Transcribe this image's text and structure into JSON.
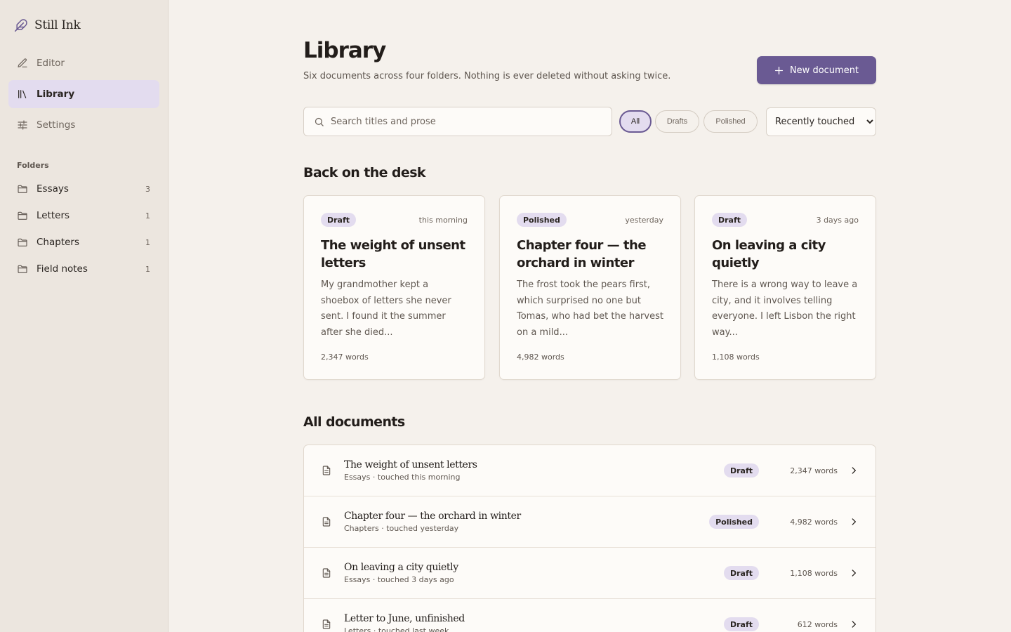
{
  "sidebar": {
    "brand": "Still Ink",
    "nav": [
      {
        "label": "Editor",
        "icon": "pen-icon"
      },
      {
        "label": "Library",
        "icon": "library-icon",
        "active": true
      },
      {
        "label": "Settings",
        "icon": "sliders-icon"
      }
    ],
    "folders_label": "Folders",
    "folders": [
      {
        "name": "Essays",
        "count": "3"
      },
      {
        "name": "Letters",
        "count": "1"
      },
      {
        "name": "Chapters",
        "count": "1"
      },
      {
        "name": "Field notes",
        "count": "1"
      }
    ]
  },
  "header": {
    "title": "Library",
    "subtitle": "Six documents across four folders. Nothing is ever deleted without asking twice.",
    "new_button": "New document"
  },
  "filters": {
    "search_placeholder": "Search titles and prose",
    "chips": [
      "All",
      "Drafts",
      "Polished"
    ],
    "active_chip": "All",
    "sort_selected": "Recently touched"
  },
  "recent": {
    "title": "Back on the desk",
    "cards": [
      {
        "status": "Draft",
        "time": "this morning",
        "title": "The weight of unsent letters",
        "excerpt": "My grandmother kept a shoebox of letters she never sent. I found it the summer after she died...",
        "words": "2,347 words"
      },
      {
        "status": "Polished",
        "time": "yesterday",
        "title": "Chapter four — the orchard in winter",
        "excerpt": "The frost took the pears first, which surprised no one but Tomas, who had bet the harvest on a mild...",
        "words": "4,982 words"
      },
      {
        "status": "Draft",
        "time": "3 days ago",
        "title": "On leaving a city quietly",
        "excerpt": "There is a wrong way to leave a city, and it involves telling everyone. I left Lisbon the right way...",
        "words": "1,108 words"
      }
    ]
  },
  "all": {
    "title": "All documents",
    "rows": [
      {
        "title": "The weight of unsent letters",
        "meta": "Essays · touched this morning",
        "status": "Draft",
        "words": "2,347 words"
      },
      {
        "title": "Chapter four — the orchard in winter",
        "meta": "Chapters · touched yesterday",
        "status": "Polished",
        "words": "4,982 words"
      },
      {
        "title": "On leaving a city quietly",
        "meta": "Essays · touched 3 days ago",
        "status": "Draft",
        "words": "1,108 words"
      },
      {
        "title": "Letter to June, unfinished",
        "meta": "Letters · touched last week",
        "status": "Draft",
        "words": "612 words"
      }
    ]
  },
  "colors": {
    "accent": "#6a5a93",
    "badge_bg": "#e3dcef",
    "page_bg": "#f5f1ec",
    "sidebar_bg": "#ece6df"
  }
}
